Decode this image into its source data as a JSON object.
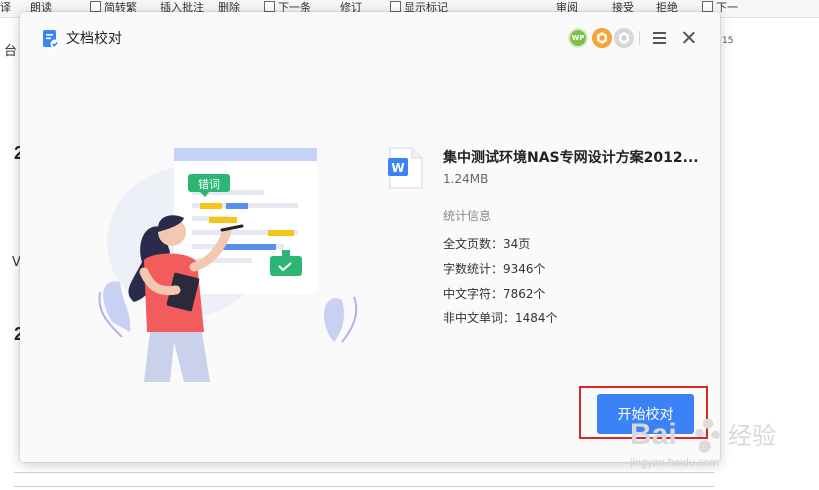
{
  "toolbar": {
    "items": [
      "译",
      "朗读",
      "简转繁",
      "插入批注",
      "删除",
      "下一条",
      "修订",
      "显示标记",
      "审阅",
      "接受",
      "拒绝",
      "下一"
    ]
  },
  "background": {
    "glyph_1": "台",
    "glyph_2": "2",
    "glyph_3": "V",
    "glyph_4": "2",
    "right_number": "15"
  },
  "dialog": {
    "title": "文档校对",
    "badges": {
      "wp": "WP",
      "vip": "",
      "svip": ""
    },
    "file": {
      "name": "集中测试环境NAS专网设计方案2012...",
      "size": "1.24MB",
      "file_type_icon": "word-doc-icon"
    },
    "stats": {
      "heading": "统计信息",
      "rows": [
        "全文页数：34页",
        "字数统计：9346个",
        "中文字符：7862个",
        "非中文单词：1484个"
      ]
    },
    "illustration": {
      "tag_text": "错词"
    },
    "start_button": "开始校对"
  },
  "watermark": {
    "line1": "Bai",
    "line2": "经验",
    "url": "jingyan.baidu.com"
  },
  "colors": {
    "accent": "#3b82f6",
    "highlight": "#e02424",
    "illus_green": "#2bb673",
    "illus_yellow": "#f5c518",
    "illus_blue": "#5b8def",
    "illus_pink": "#f25c5c"
  }
}
